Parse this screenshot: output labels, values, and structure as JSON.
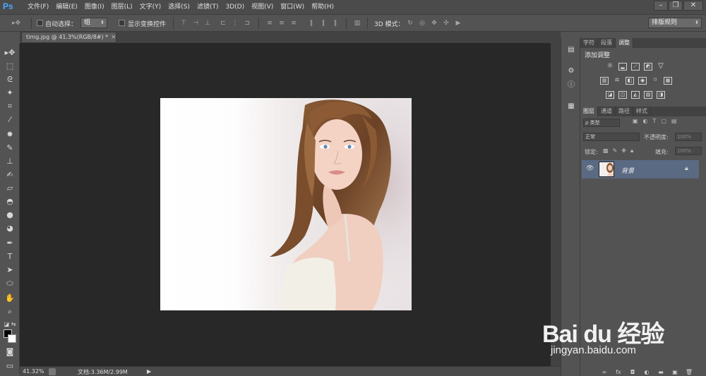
{
  "app": {
    "logo": "Ps"
  },
  "menu": [
    "文件(F)",
    "编辑(E)",
    "图像(I)",
    "图层(L)",
    "文字(Y)",
    "选择(S)",
    "滤镜(T)",
    "3D(D)",
    "视图(V)",
    "窗口(W)",
    "帮助(H)"
  ],
  "window_controls": {
    "minimize": "–",
    "restore": "❐",
    "close": "✕"
  },
  "options": {
    "auto_select_label": "自动选择：",
    "auto_select_value": "组",
    "show_transform_label": "显示变换控件",
    "mode_3d_label": "3D 模式：",
    "workspace_value": "排版规则"
  },
  "document": {
    "tab_title": "timg.jpg @ 41.3%(RGB/8#) *",
    "zoom": "41.32%",
    "doc_info": "文档:3.36M/2.99M"
  },
  "panels": {
    "top_tabs": [
      "字符",
      "段落",
      "调整"
    ],
    "active_top_tab": "调整",
    "adjust_title": "添加调整",
    "layer_tabs": [
      "图层",
      "通道",
      "路径",
      "样式"
    ],
    "active_layer_tab": "图层",
    "filter_kind": "ρ 类型",
    "blend_mode": "正常",
    "opacity_label": "不透明度:",
    "opacity_value": "100%",
    "lock_label": "锁定:",
    "fill_label": "填充:",
    "fill_value": "100%",
    "layer_name": "背景"
  },
  "watermark": {
    "brand": "Bai du 经验",
    "url": "jingyan.baidu.com"
  },
  "colors": {
    "accent": "#4aa8ff",
    "selected_layer": "#5a6a82",
    "canvas_bg": "#282828"
  }
}
